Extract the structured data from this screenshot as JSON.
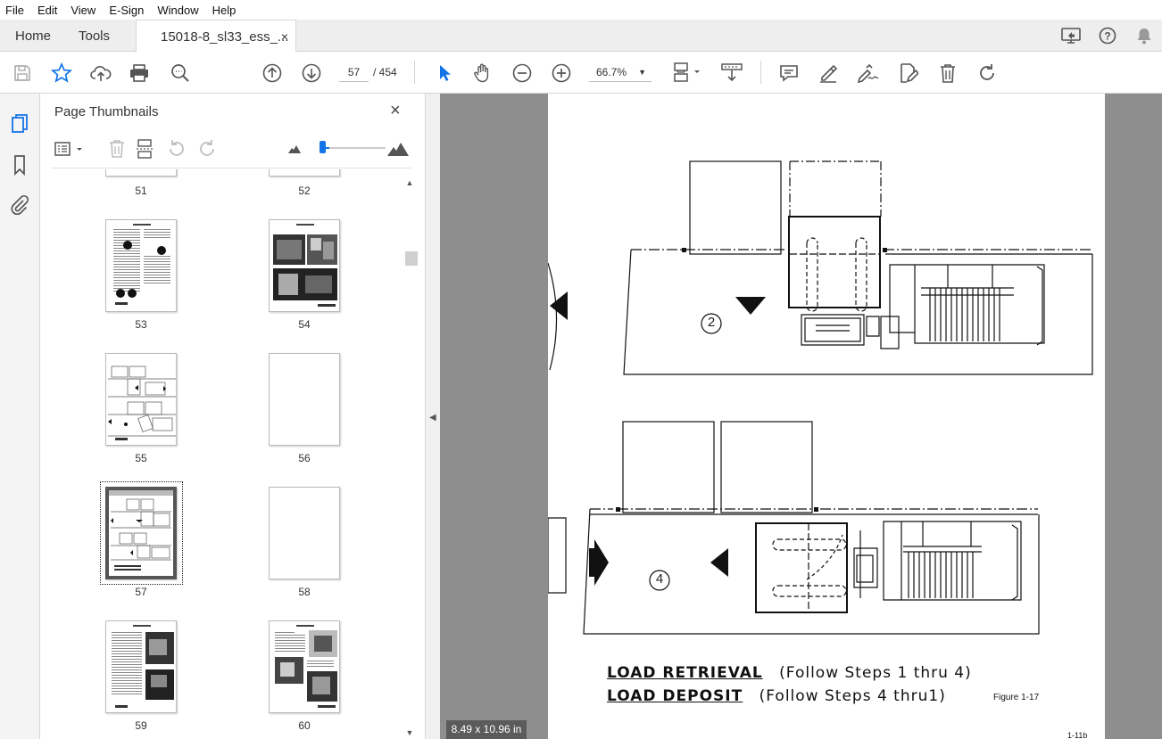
{
  "menu": [
    "File",
    "Edit",
    "View",
    "E-Sign",
    "Window",
    "Help"
  ],
  "tabs": {
    "home": "Home",
    "tools": "Tools",
    "document": "15018-8_sl33_ess_...",
    "close": "×"
  },
  "toolbar": {
    "current_page": "57",
    "total_pages": "/ 454",
    "zoom": "66.7%"
  },
  "panel": {
    "title": "Page Thumbnails",
    "close": "×"
  },
  "thumbnails": [
    {
      "label": "51"
    },
    {
      "label": "52"
    },
    {
      "label": "53"
    },
    {
      "label": "54"
    },
    {
      "label": "55"
    },
    {
      "label": "56"
    },
    {
      "label": "57",
      "selected": true
    },
    {
      "label": "58"
    },
    {
      "label": "59"
    },
    {
      "label": "60"
    }
  ],
  "document": {
    "step_a": "2",
    "step_b": "4",
    "caption_line1_u": "LOAD  RETRIEVAL",
    "caption_line1_rest": "(Follow  Steps 1 thru 4)",
    "caption_line2_u": "LOAD  DEPOSIT",
    "caption_line2_rest": "(Follow  Steps 4 thru1)",
    "figure": "Figure 1-17",
    "page_number": "1-11b"
  },
  "page_size": "8.49 x 10.96 in",
  "colors": {
    "accent": "#1473e6",
    "viewer_bg": "#8e8e8e"
  }
}
